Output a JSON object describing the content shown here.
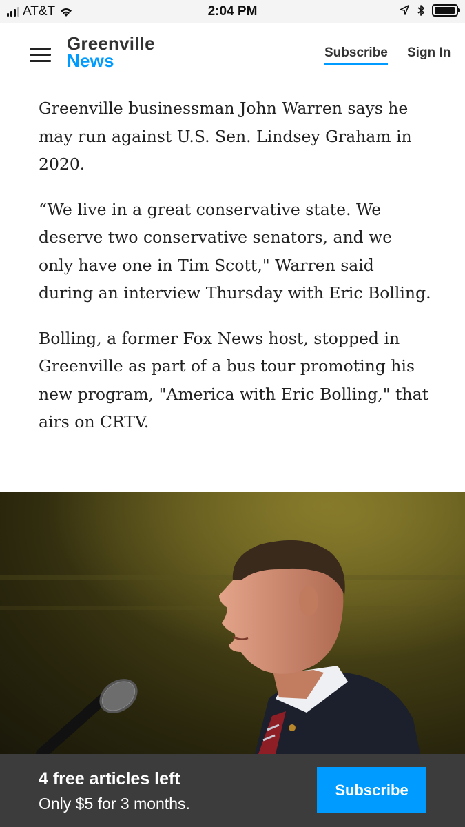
{
  "status_bar": {
    "carrier": "AT&T",
    "time": "2:04 PM",
    "icons": [
      "signal-icon",
      "wifi-icon",
      "location-icon",
      "bluetooth-icon",
      "battery-icon"
    ]
  },
  "header": {
    "logo_line1": "Greenville",
    "logo_line2": "News",
    "subscribe_label": "Subscribe",
    "signin_label": "Sign In",
    "icons": [
      "hamburger-menu-icon"
    ]
  },
  "article": {
    "paragraphs": [
      "Greenville businessman John Warren says he may run against U.S. Sen. Lindsey Graham in 2020.",
      "“We live in a great conservative state. We deserve two conservative senators, and we only have one in Tim Scott,\" Warren said during an interview Thursday with Eric Bolling.",
      "Bolling, a former Fox News host, stopped in Greenville as part of a bus tour promoting his new program, \"America with Eric Bolling,\" that airs on CRTV."
    ]
  },
  "paywall": {
    "title": "4 free articles left",
    "offer": "Only $5 for 3 months.",
    "button_label": "Subscribe"
  },
  "colors": {
    "brand_blue": "#009bff",
    "logo_dark": "#333333",
    "paywall_bg": "#3c3c3c"
  }
}
